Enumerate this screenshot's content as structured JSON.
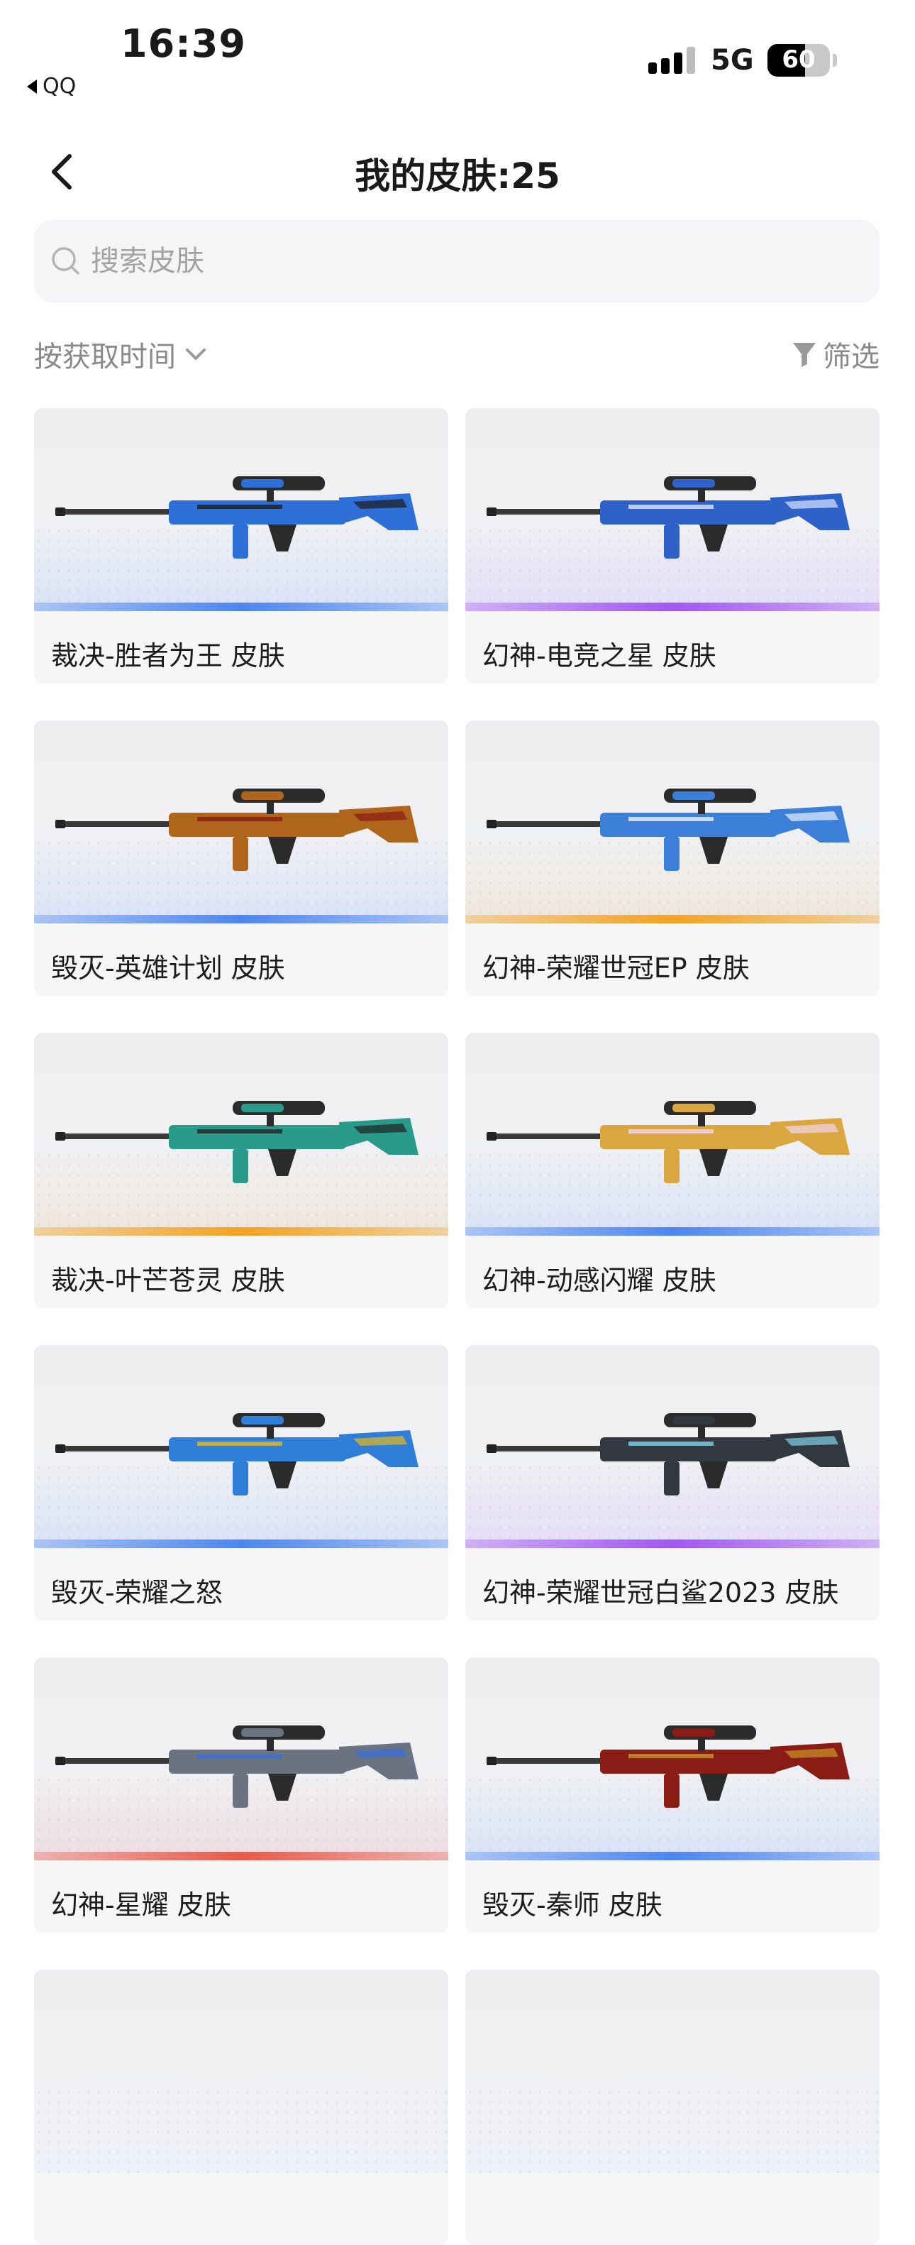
{
  "status_bar": {
    "time": "16:39",
    "back_app": "QQ",
    "network": "5G",
    "battery": "60"
  },
  "nav": {
    "title": "我的皮肤:25"
  },
  "search": {
    "placeholder": "搜索皮肤"
  },
  "filters": {
    "sort_label": "按获取时间",
    "filter_label": "筛选"
  },
  "colors": {
    "blue": "#4d86f0",
    "purple": "#a257f2",
    "orange": "#f3a222",
    "red": "#ea5a4a"
  },
  "items": [
    {
      "label": "裁决-胜者为王 皮肤",
      "rarity": "blue",
      "gun_color": "#2f6fd8",
      "accent": "#1b1b1b"
    },
    {
      "label": "幻神-电竞之星 皮肤",
      "rarity": "purple",
      "gun_color": "#2e62c8",
      "accent": "#d9e6ff"
    },
    {
      "label": "毁灭-英雄计划 皮肤",
      "rarity": "blue",
      "gun_color": "#b0651d",
      "accent": "#8a1a12"
    },
    {
      "label": "幻神-荣耀世冠EP 皮肤",
      "rarity": "orange",
      "gun_color": "#3b7fd8",
      "accent": "#e8f0ff"
    },
    {
      "label": "裁决-叶芒苍灵 皮肤",
      "rarity": "orange",
      "gun_color": "#2a9a8a",
      "accent": "#222222"
    },
    {
      "label": "幻神-动感闪耀 皮肤",
      "rarity": "blue",
      "gun_color": "#d9a640",
      "accent": "#f4d7f0"
    },
    {
      "label": "毁灭-荣耀之怒",
      "rarity": "blue",
      "gun_color": "#2f7fd8",
      "accent": "#e6b820"
    },
    {
      "label": "幻神-荣耀世冠白鲨2023 皮肤",
      "rarity": "purple",
      "gun_color": "#333840",
      "accent": "#7fd3e8"
    },
    {
      "label": "幻神-星耀 皮肤",
      "rarity": "red",
      "gun_color": "#6b7280",
      "accent": "#3b6fd8"
    },
    {
      "label": "毁灭-秦师 皮肤",
      "rarity": "blue",
      "gun_color": "#8a1c16",
      "accent": "#c9962a"
    }
  ]
}
